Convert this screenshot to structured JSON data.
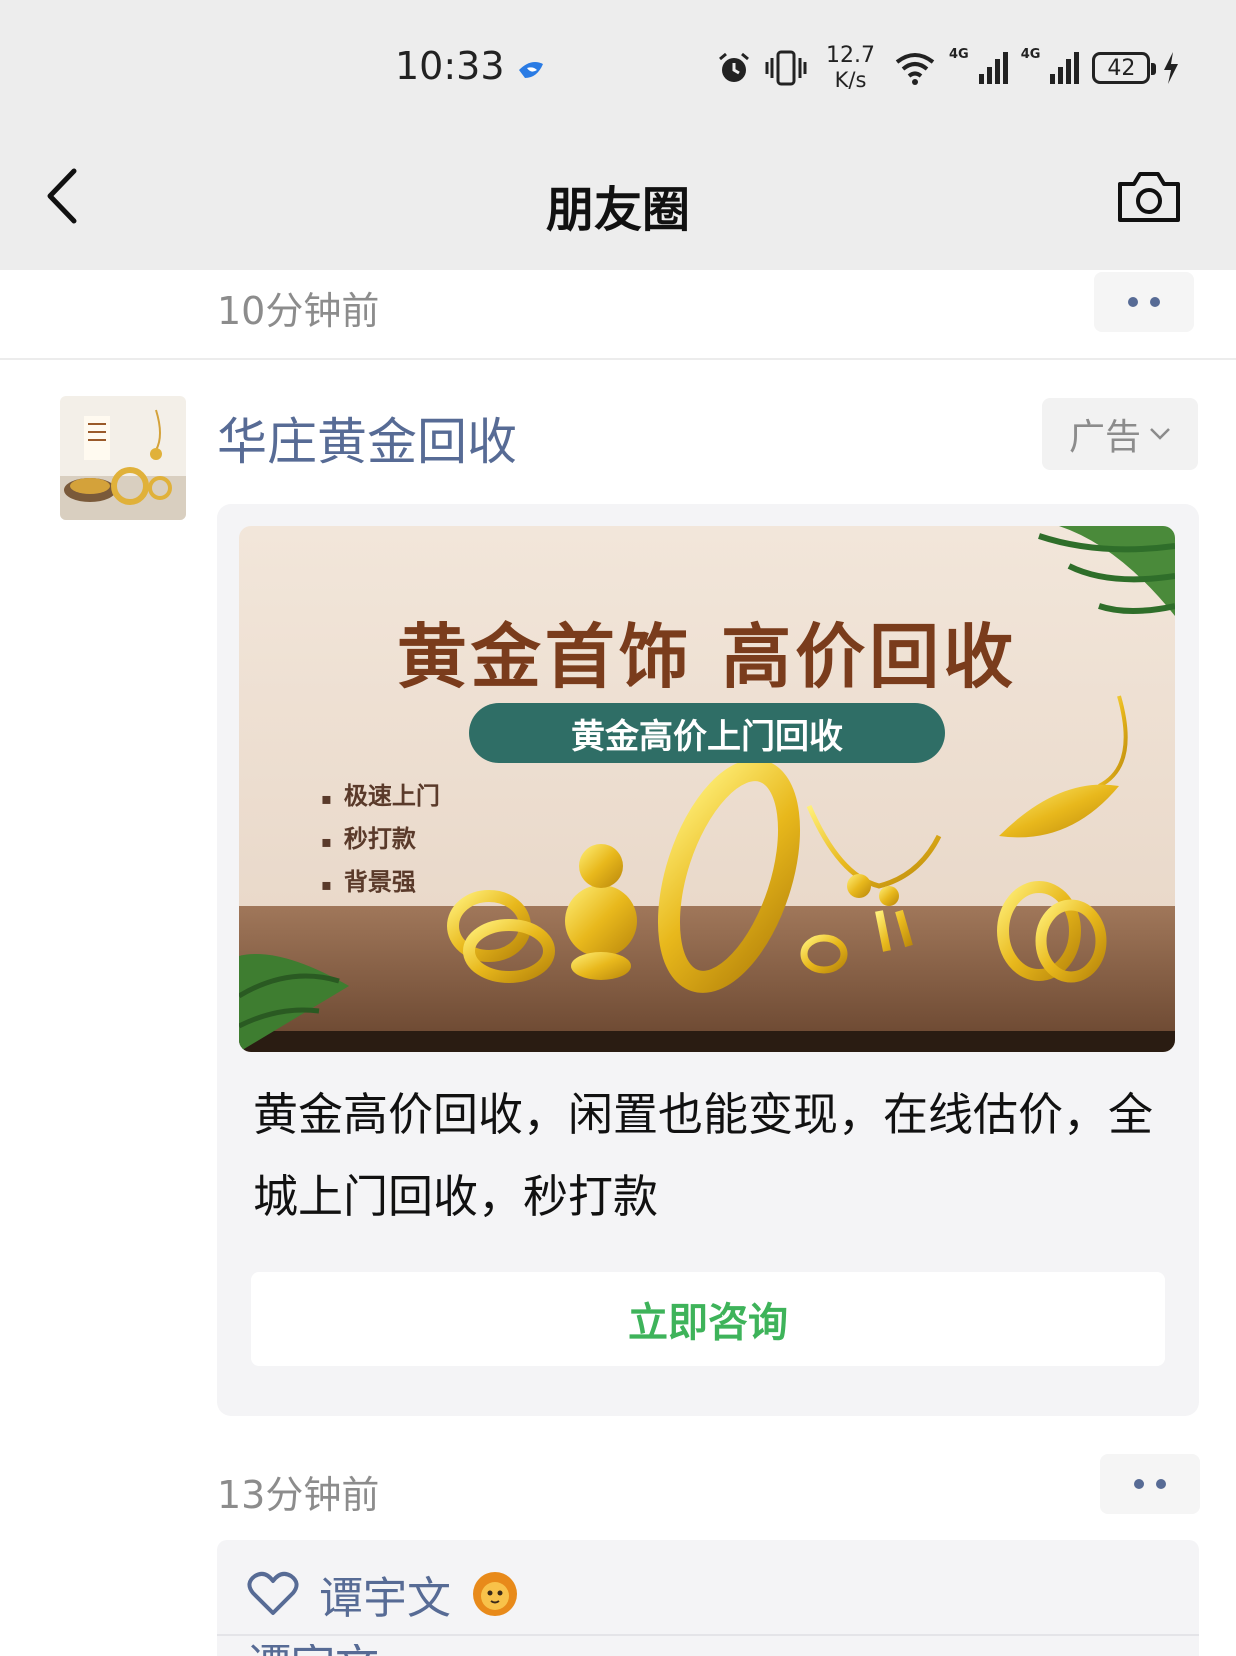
{
  "status_bar": {
    "time": "10:33",
    "net_speed_value": "12.7",
    "net_speed_unit": "K/s",
    "signal1_label": "4G",
    "signal2_label": "4G",
    "battery": "42",
    "icons": [
      "app-notification-icon",
      "alarm-icon",
      "vibrate-icon",
      "wifi-icon",
      "signal-icon",
      "signal-icon",
      "battery-icon",
      "charging-icon"
    ]
  },
  "nav": {
    "title": "朋友圈",
    "back_icon": "back-chevron-icon",
    "camera_icon": "camera-icon"
  },
  "previous_post": {
    "time_ago": "10分钟前"
  },
  "ad_post": {
    "sender": "华庄黄金回收",
    "ad_label": "广告",
    "banner": {
      "headline": "黄金首饰 高价回收",
      "pill": "黄金高价上门回收",
      "features": [
        "极速上门",
        "秒打款",
        "背景强"
      ]
    },
    "text": "黄金高价回收，闲置也能变现，在线估价，全城上门回收，秒打款",
    "cta": "立即咨询",
    "time_ago": "13分钟前",
    "likes": [
      "谭宇文"
    ],
    "comment_peek": "谭宇文"
  },
  "colors": {
    "link_blue": "#576b95",
    "cta_green": "#3eb35a",
    "header_bg": "#ededed",
    "card_bg": "#f4f4f6"
  }
}
